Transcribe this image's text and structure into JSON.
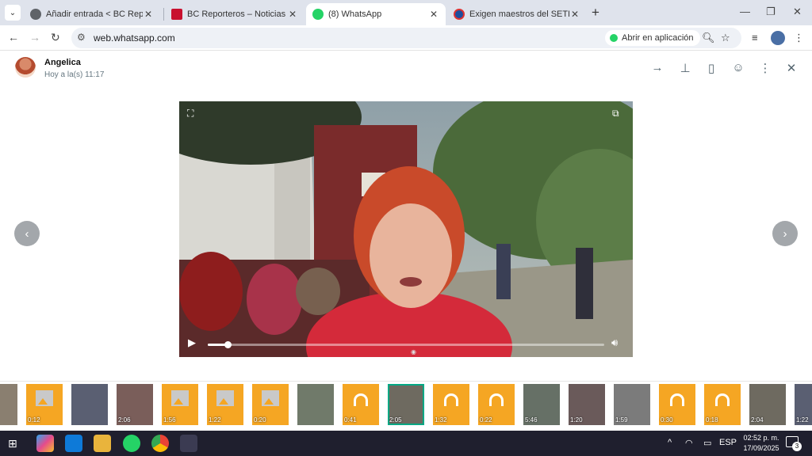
{
  "browser": {
    "tabs": [
      {
        "title": "Añadir entrada < BC Reporteros",
        "active": false
      },
      {
        "title": "BC Reporteros – Noticias",
        "active": false
      },
      {
        "title": "(8) WhatsApp",
        "active": true
      },
      {
        "title": "Exigen maestros del SETE pago",
        "active": false
      }
    ],
    "url": "web.whatsapp.com",
    "open_in_app_label": "Abrir en aplicación"
  },
  "viewer": {
    "sender_name": "Angelica",
    "timestamp": "Hoy a la(s) 11:17",
    "video_progress": 0.05
  },
  "thumbnails": [
    {
      "kind": "photo",
      "duration": ""
    },
    {
      "kind": "image",
      "duration": "0:12"
    },
    {
      "kind": "photo",
      "duration": ""
    },
    {
      "kind": "photo",
      "duration": "2:06"
    },
    {
      "kind": "image",
      "duration": "1:56"
    },
    {
      "kind": "image",
      "duration": "1:22"
    },
    {
      "kind": "image",
      "duration": "0:20"
    },
    {
      "kind": "photo",
      "duration": ""
    },
    {
      "kind": "audio",
      "duration": "0:41"
    },
    {
      "kind": "photo",
      "duration": "2:05",
      "selected": true
    },
    {
      "kind": "audio",
      "duration": "1:32"
    },
    {
      "kind": "audio",
      "duration": "0:22"
    },
    {
      "kind": "photo",
      "duration": "5:46"
    },
    {
      "kind": "photo",
      "duration": "1:20"
    },
    {
      "kind": "photo",
      "duration": "1:59"
    },
    {
      "kind": "audio",
      "duration": "0:30"
    },
    {
      "kind": "audio",
      "duration": "0:18"
    },
    {
      "kind": "photo",
      "duration": "2:04"
    },
    {
      "kind": "photo",
      "duration": "1:22"
    }
  ],
  "taskbar": {
    "language": "ESP",
    "time": "02:52 p. m.",
    "date": "17/09/2025",
    "notifications": "3"
  },
  "colors": {
    "whatsapp_green": "#25d366",
    "selection": "#00a884",
    "audio_thumb": "#f5a623"
  }
}
